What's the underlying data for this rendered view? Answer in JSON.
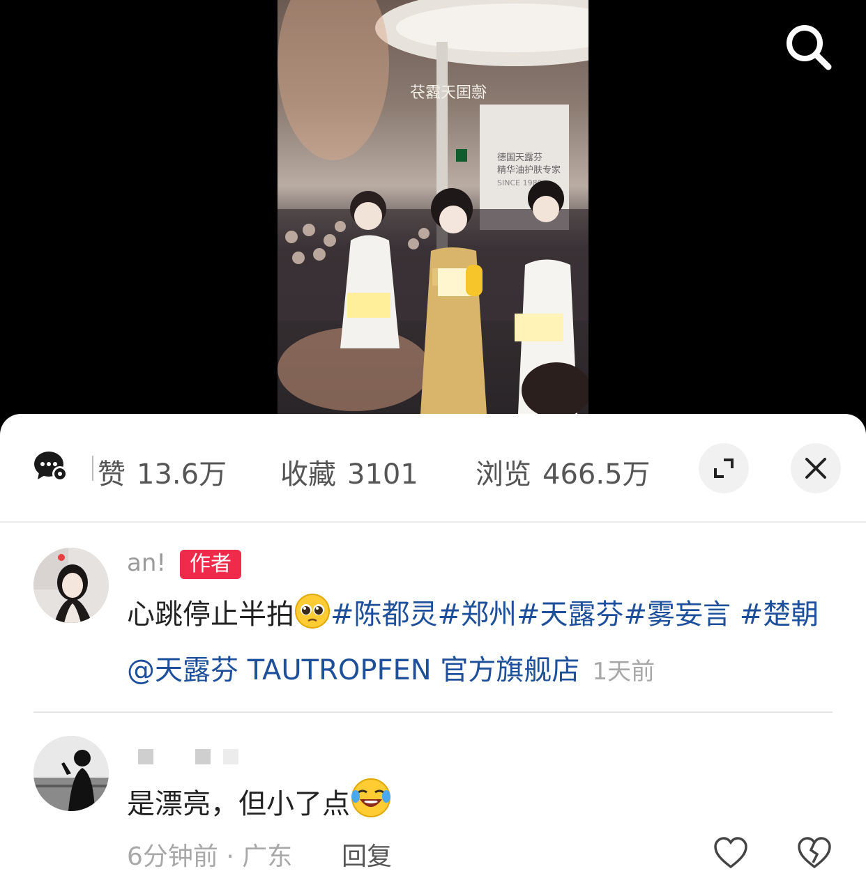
{
  "stats": {
    "likes_label_partial": "赞",
    "likes_value": "13.6万",
    "fav_label": "收藏",
    "fav_value": "3101",
    "views_label": "浏览",
    "views_value": "466.5万"
  },
  "video": {
    "sign_text": "德国天露芬",
    "poster_line1": "德国天露芬",
    "poster_line2": "精华油护肤专家",
    "poster_line3": "SINCE 1980"
  },
  "author_comment": {
    "name": "an!",
    "badge": "作者",
    "text_plain": "心跳停止半拍",
    "tags": "#陈都灵#郑州#天露芬#雾妄言 #楚朝",
    "mention": "@天露芬 TAUTROPFEN 官方旗舰店",
    "time": "1天前"
  },
  "reply_comment": {
    "text": "是漂亮，但小了点",
    "time_location": "6分钟前 · 广东",
    "reply_label": "回复"
  },
  "colors": {
    "accent_red": "#f02a4b",
    "tag_blue": "#1e4f9a"
  }
}
